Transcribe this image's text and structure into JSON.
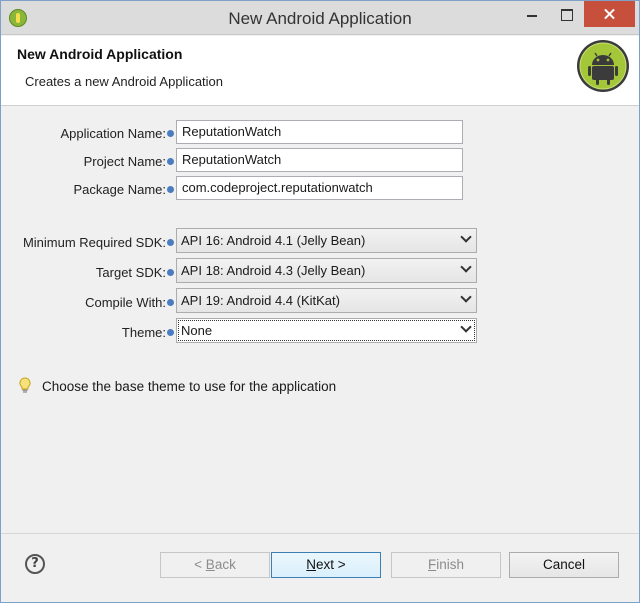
{
  "window": {
    "title": "New Android Application"
  },
  "banner": {
    "title": "New Android Application",
    "description": "Creates a new Android Application"
  },
  "form": {
    "application_name": {
      "label": "Application Name:",
      "value": "ReputationWatch"
    },
    "project_name": {
      "label": "Project Name:",
      "value": "ReputationWatch"
    },
    "package_name": {
      "label": "Package Name:",
      "value": "com.codeproject.reputationwatch"
    },
    "min_sdk": {
      "label": "Minimum Required SDK:",
      "value": "API 16: Android 4.1 (Jelly Bean)"
    },
    "target_sdk": {
      "label": "Target SDK:",
      "value": "API 18: Android 4.3 (Jelly Bean)"
    },
    "compile_with": {
      "label": "Compile With:",
      "value": "API 19: Android 4.4 (KitKat)"
    },
    "theme": {
      "label": "Theme:",
      "value": "None"
    }
  },
  "hint": {
    "text": "Choose the base theme to use for the application",
    "icon": "lightbulb-icon"
  },
  "buttons": {
    "back": {
      "prefix": "< ",
      "mnemonic": "B",
      "rest": "ack"
    },
    "next": {
      "mnemonic": "N",
      "rest": "ext >"
    },
    "finish": {
      "mnemonic": "F",
      "rest": "inish"
    },
    "cancel": "Cancel"
  },
  "colors": {
    "close_button": "#c7503d",
    "default_button_border": "#3c7fb1",
    "android_green": "#a4c639"
  }
}
